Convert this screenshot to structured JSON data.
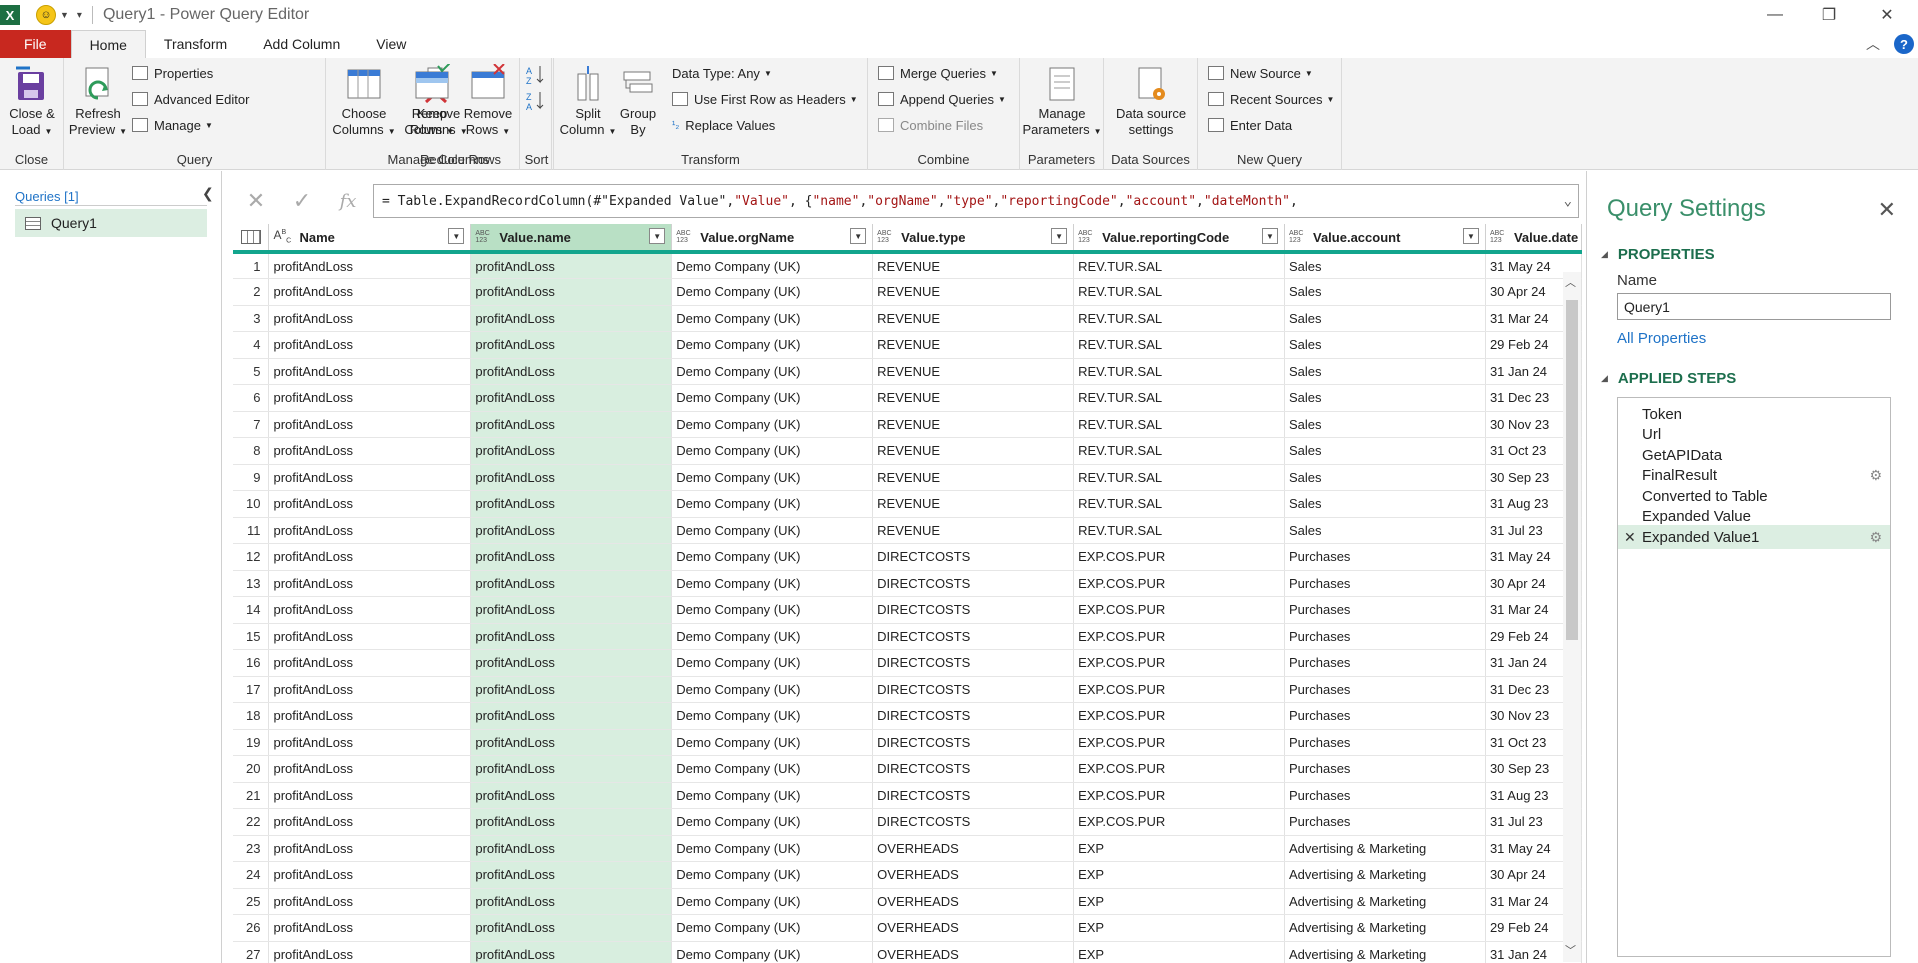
{
  "window": {
    "title": "Query1 - Power Query Editor"
  },
  "tabs": [
    {
      "label": "File"
    },
    {
      "label": "Home"
    },
    {
      "label": "Transform"
    },
    {
      "label": "Add Column"
    },
    {
      "label": "View"
    }
  ],
  "ribbon": {
    "groups": {
      "close": "Close",
      "query": "Query",
      "manage_columns": "Manage Columns",
      "reduce_rows": "Reduce Rows",
      "sort": "Sort",
      "transform": "Transform",
      "combine": "Combine",
      "parameters": "Parameters",
      "data_sources": "Data Sources",
      "new_query": "New Query"
    },
    "close_load": [
      "Close &",
      "Load"
    ],
    "refresh_preview": [
      "Refresh",
      "Preview"
    ],
    "properties": "Properties",
    "advanced_editor": "Advanced Editor",
    "manage": "Manage",
    "choose_columns": [
      "Choose",
      "Columns"
    ],
    "remove_columns": [
      "Remove",
      "Columns"
    ],
    "keep_rows": [
      "Keep",
      "Rows"
    ],
    "remove_rows": [
      "Remove",
      "Rows"
    ],
    "split_column": [
      "Split",
      "Column"
    ],
    "group_by": [
      "Group",
      "By"
    ],
    "data_type": "Data Type: Any",
    "use_first_row": "Use First Row as Headers",
    "replace_values": "Replace Values",
    "merge_queries": "Merge Queries",
    "append_queries": "Append Queries",
    "combine_files": "Combine Files",
    "manage_parameters": [
      "Manage",
      "Parameters"
    ],
    "data_source_settings": [
      "Data source",
      "settings"
    ],
    "new_source": "New Source",
    "recent_sources": "Recent Sources",
    "enter_data": "Enter Data"
  },
  "queries": {
    "header": "Queries [1]",
    "items": [
      "Query1"
    ]
  },
  "formula": {
    "prefix": "= Table.ExpandRecordColumn(#\"Expanded Value\", ",
    "s1": "\"Value\"",
    "mid": ", {",
    "s2": "\"name\"",
    "c1": ", ",
    "s3": "\"orgName\"",
    "c2": ", ",
    "s4": "\"type\"",
    "c3": ", ",
    "s5": "\"reportingCode\"",
    "c4": ", ",
    "s6": "\"account\"",
    "c5": ", ",
    "s7": "\"dateMonth\"",
    "end": ","
  },
  "columns": [
    {
      "name": "Name",
      "type": "ABC"
    },
    {
      "name": "Value.name",
      "type": "ABC/123",
      "selected": true
    },
    {
      "name": "Value.orgName",
      "type": "ABC/123"
    },
    {
      "name": "Value.type",
      "type": "ABC/123"
    },
    {
      "name": "Value.reportingCode",
      "type": "ABC/123"
    },
    {
      "name": "Value.account",
      "type": "ABC/123"
    },
    {
      "name": "Value.date",
      "type": "ABC/123"
    }
  ],
  "rows": [
    [
      "1",
      "profitAndLoss",
      "profitAndLoss",
      "Demo Company (UK)",
      "REVENUE",
      "REV.TUR.SAL",
      "Sales",
      "31 May 24"
    ],
    [
      "2",
      "profitAndLoss",
      "profitAndLoss",
      "Demo Company (UK)",
      "REVENUE",
      "REV.TUR.SAL",
      "Sales",
      "30 Apr 24"
    ],
    [
      "3",
      "profitAndLoss",
      "profitAndLoss",
      "Demo Company (UK)",
      "REVENUE",
      "REV.TUR.SAL",
      "Sales",
      "31 Mar 24"
    ],
    [
      "4",
      "profitAndLoss",
      "profitAndLoss",
      "Demo Company (UK)",
      "REVENUE",
      "REV.TUR.SAL",
      "Sales",
      "29 Feb 24"
    ],
    [
      "5",
      "profitAndLoss",
      "profitAndLoss",
      "Demo Company (UK)",
      "REVENUE",
      "REV.TUR.SAL",
      "Sales",
      "31 Jan 24"
    ],
    [
      "6",
      "profitAndLoss",
      "profitAndLoss",
      "Demo Company (UK)",
      "REVENUE",
      "REV.TUR.SAL",
      "Sales",
      "31 Dec 23"
    ],
    [
      "7",
      "profitAndLoss",
      "profitAndLoss",
      "Demo Company (UK)",
      "REVENUE",
      "REV.TUR.SAL",
      "Sales",
      "30 Nov 23"
    ],
    [
      "8",
      "profitAndLoss",
      "profitAndLoss",
      "Demo Company (UK)",
      "REVENUE",
      "REV.TUR.SAL",
      "Sales",
      "31 Oct 23"
    ],
    [
      "9",
      "profitAndLoss",
      "profitAndLoss",
      "Demo Company (UK)",
      "REVENUE",
      "REV.TUR.SAL",
      "Sales",
      "30 Sep 23"
    ],
    [
      "10",
      "profitAndLoss",
      "profitAndLoss",
      "Demo Company (UK)",
      "REVENUE",
      "REV.TUR.SAL",
      "Sales",
      "31 Aug 23"
    ],
    [
      "11",
      "profitAndLoss",
      "profitAndLoss",
      "Demo Company (UK)",
      "REVENUE",
      "REV.TUR.SAL",
      "Sales",
      "31 Jul 23"
    ],
    [
      "12",
      "profitAndLoss",
      "profitAndLoss",
      "Demo Company (UK)",
      "DIRECTCOSTS",
      "EXP.COS.PUR",
      "Purchases",
      "31 May 24"
    ],
    [
      "13",
      "profitAndLoss",
      "profitAndLoss",
      "Demo Company (UK)",
      "DIRECTCOSTS",
      "EXP.COS.PUR",
      "Purchases",
      "30 Apr 24"
    ],
    [
      "14",
      "profitAndLoss",
      "profitAndLoss",
      "Demo Company (UK)",
      "DIRECTCOSTS",
      "EXP.COS.PUR",
      "Purchases",
      "31 Mar 24"
    ],
    [
      "15",
      "profitAndLoss",
      "profitAndLoss",
      "Demo Company (UK)",
      "DIRECTCOSTS",
      "EXP.COS.PUR",
      "Purchases",
      "29 Feb 24"
    ],
    [
      "16",
      "profitAndLoss",
      "profitAndLoss",
      "Demo Company (UK)",
      "DIRECTCOSTS",
      "EXP.COS.PUR",
      "Purchases",
      "31 Jan 24"
    ],
    [
      "17",
      "profitAndLoss",
      "profitAndLoss",
      "Demo Company (UK)",
      "DIRECTCOSTS",
      "EXP.COS.PUR",
      "Purchases",
      "31 Dec 23"
    ],
    [
      "18",
      "profitAndLoss",
      "profitAndLoss",
      "Demo Company (UK)",
      "DIRECTCOSTS",
      "EXP.COS.PUR",
      "Purchases",
      "30 Nov 23"
    ],
    [
      "19",
      "profitAndLoss",
      "profitAndLoss",
      "Demo Company (UK)",
      "DIRECTCOSTS",
      "EXP.COS.PUR",
      "Purchases",
      "31 Oct 23"
    ],
    [
      "20",
      "profitAndLoss",
      "profitAndLoss",
      "Demo Company (UK)",
      "DIRECTCOSTS",
      "EXP.COS.PUR",
      "Purchases",
      "30 Sep 23"
    ],
    [
      "21",
      "profitAndLoss",
      "profitAndLoss",
      "Demo Company (UK)",
      "DIRECTCOSTS",
      "EXP.COS.PUR",
      "Purchases",
      "31 Aug 23"
    ],
    [
      "22",
      "profitAndLoss",
      "profitAndLoss",
      "Demo Company (UK)",
      "DIRECTCOSTS",
      "EXP.COS.PUR",
      "Purchases",
      "31 Jul 23"
    ],
    [
      "23",
      "profitAndLoss",
      "profitAndLoss",
      "Demo Company (UK)",
      "OVERHEADS",
      "EXP",
      "Advertising & Marketing",
      "31 May 24"
    ],
    [
      "24",
      "profitAndLoss",
      "profitAndLoss",
      "Demo Company (UK)",
      "OVERHEADS",
      "EXP",
      "Advertising & Marketing",
      "30 Apr 24"
    ],
    [
      "25",
      "profitAndLoss",
      "profitAndLoss",
      "Demo Company (UK)",
      "OVERHEADS",
      "EXP",
      "Advertising & Marketing",
      "31 Mar 24"
    ],
    [
      "26",
      "profitAndLoss",
      "profitAndLoss",
      "Demo Company (UK)",
      "OVERHEADS",
      "EXP",
      "Advertising & Marketing",
      "29 Feb 24"
    ],
    [
      "27",
      "profitAndLoss",
      "profitAndLoss",
      "Demo Company (UK)",
      "OVERHEADS",
      "EXP",
      "Advertising & Marketing",
      "31 Jan 24"
    ]
  ],
  "settings": {
    "title": "Query Settings",
    "properties_header": "PROPERTIES",
    "name_label": "Name",
    "name_value": "Query1",
    "all_properties": "All Properties",
    "applied_steps_header": "APPLIED STEPS",
    "steps": [
      {
        "label": "Token",
        "gear": false
      },
      {
        "label": "Url",
        "gear": false
      },
      {
        "label": "GetAPIData",
        "gear": false
      },
      {
        "label": "FinalResult",
        "gear": true
      },
      {
        "label": "Converted to Table",
        "gear": false
      },
      {
        "label": "Expanded Value",
        "gear": false
      },
      {
        "label": "Expanded Value1",
        "gear": true,
        "active": true
      }
    ]
  },
  "colors": {
    "accent": "#12a58d",
    "file_tab": "#c8281f",
    "selected_col": "#d8eedf",
    "settings_title": "#3a8f6a"
  }
}
